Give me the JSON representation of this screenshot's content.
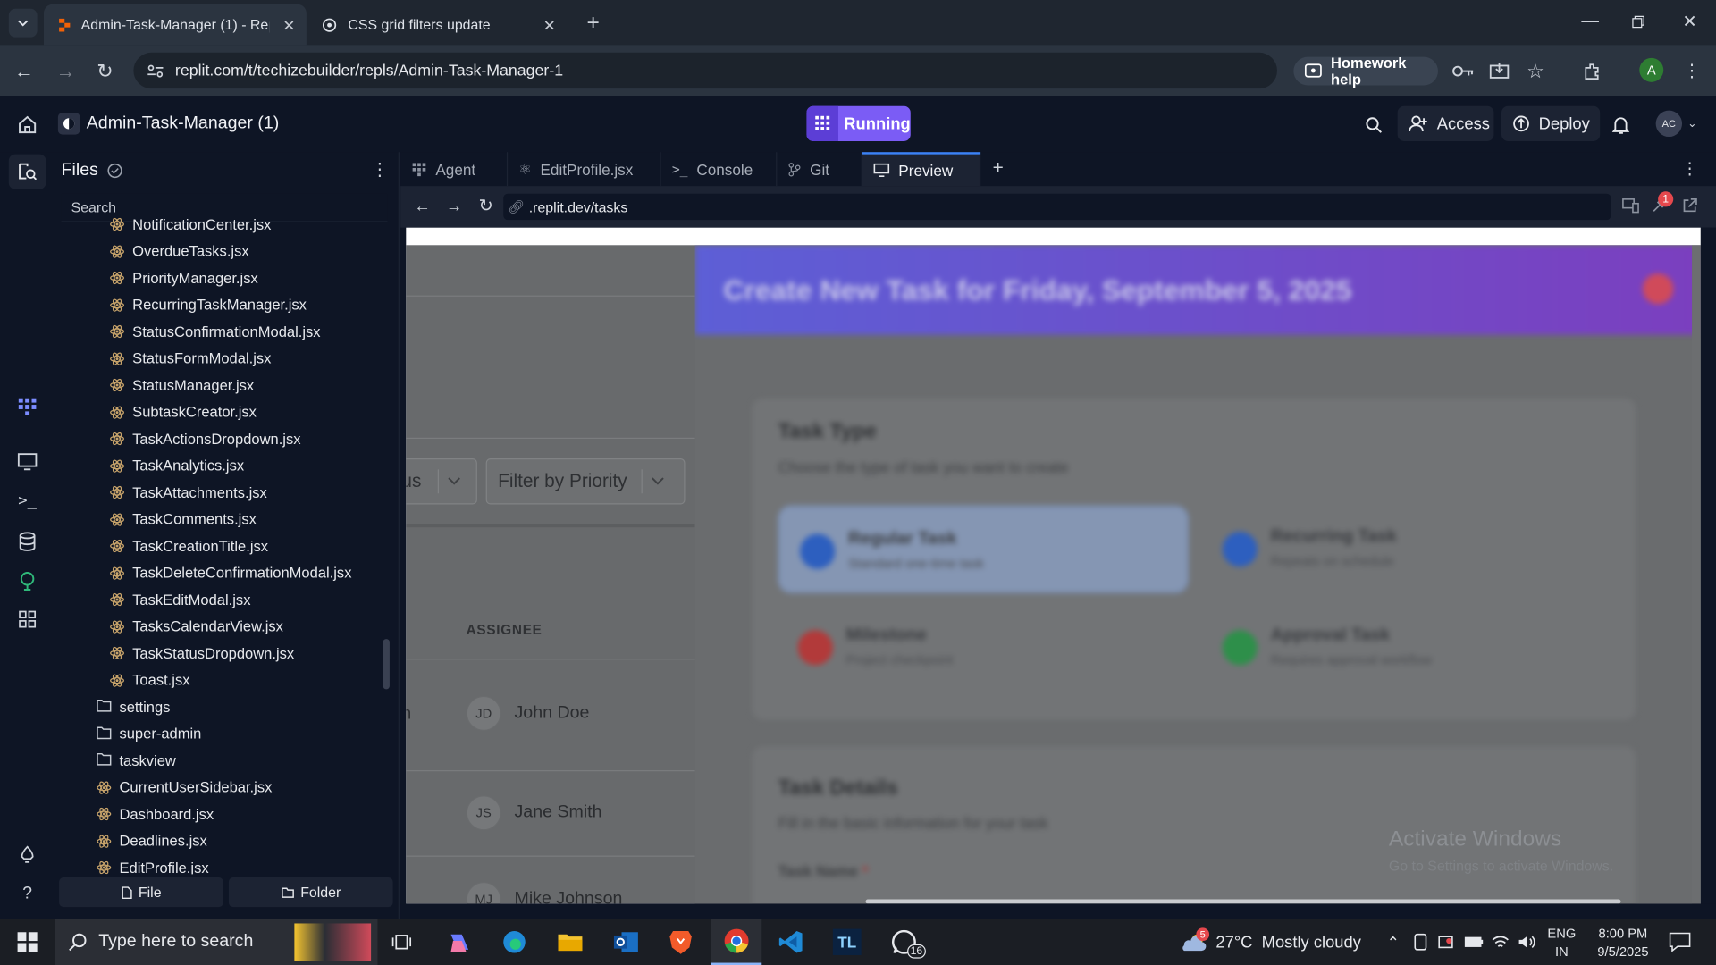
{
  "browser": {
    "tabs": [
      {
        "title": "Admin-Task-Manager (1) - Repl",
        "active": true
      },
      {
        "title": "CSS grid filters update",
        "active": false
      }
    ],
    "url": "replit.com/t/techizebuilder/repls/Admin-Task-Manager-1",
    "homework_help": "Homework help",
    "profile_initial": "A"
  },
  "replit": {
    "project_name": "Admin-Task-Manager (1)",
    "status": "Running",
    "access_label": "Access",
    "deploy_label": "Deploy",
    "avatar_initials": "AC"
  },
  "files": {
    "title": "Files",
    "search_placeholder": "Search",
    "items": [
      {
        "name": "NotificationCenter.jsx",
        "type": "jsx",
        "indent": 2
      },
      {
        "name": "OverdueTasks.jsx",
        "type": "jsx",
        "indent": 2
      },
      {
        "name": "PriorityManager.jsx",
        "type": "jsx",
        "indent": 2
      },
      {
        "name": "RecurringTaskManager.jsx",
        "type": "jsx",
        "indent": 2
      },
      {
        "name": "StatusConfirmationModal.jsx",
        "type": "jsx",
        "indent": 2
      },
      {
        "name": "StatusFormModal.jsx",
        "type": "jsx",
        "indent": 2
      },
      {
        "name": "StatusManager.jsx",
        "type": "jsx",
        "indent": 2
      },
      {
        "name": "SubtaskCreator.jsx",
        "type": "jsx",
        "indent": 2
      },
      {
        "name": "TaskActionsDropdown.jsx",
        "type": "jsx",
        "indent": 2
      },
      {
        "name": "TaskAnalytics.jsx",
        "type": "jsx",
        "indent": 2
      },
      {
        "name": "TaskAttachments.jsx",
        "type": "jsx",
        "indent": 2
      },
      {
        "name": "TaskComments.jsx",
        "type": "jsx",
        "indent": 2
      },
      {
        "name": "TaskCreationTitle.jsx",
        "type": "jsx",
        "indent": 2
      },
      {
        "name": "TaskDeleteConfirmationModal.jsx",
        "type": "jsx",
        "indent": 2
      },
      {
        "name": "TaskEditModal.jsx",
        "type": "jsx",
        "indent": 2
      },
      {
        "name": "TasksCalendarView.jsx",
        "type": "jsx",
        "indent": 2
      },
      {
        "name": "TaskStatusDropdown.jsx",
        "type": "jsx",
        "indent": 2
      },
      {
        "name": "Toast.jsx",
        "type": "jsx",
        "indent": 2
      },
      {
        "name": "settings",
        "type": "folder",
        "indent": 1
      },
      {
        "name": "super-admin",
        "type": "folder",
        "indent": 1
      },
      {
        "name": "taskview",
        "type": "folder",
        "indent": 1
      },
      {
        "name": "CurrentUserSidebar.jsx",
        "type": "jsx",
        "indent": 1
      },
      {
        "name": "Dashboard.jsx",
        "type": "jsx",
        "indent": 1
      },
      {
        "name": "Deadlines.jsx",
        "type": "jsx",
        "indent": 1
      },
      {
        "name": "EditProfile.jsx",
        "type": "jsx",
        "indent": 1
      }
    ],
    "new_file_label": "File",
    "new_folder_label": "Folder"
  },
  "editor_tabs": [
    {
      "label": "Agent",
      "icon": "agent-icon",
      "active": false
    },
    {
      "label": "EditProfile.jsx",
      "icon": "react-icon",
      "active": false
    },
    {
      "label": "Console",
      "icon": "console-icon",
      "active": false
    },
    {
      "label": "Git",
      "icon": "git-icon",
      "active": false
    },
    {
      "label": "Preview",
      "icon": "monitor-icon",
      "active": true
    }
  ],
  "preview": {
    "url": ".replit.dev/tasks",
    "notification_count": "1",
    "app": {
      "filter_status_partial": "us",
      "filter_priority": "Filter by Priority",
      "assignee_header": "ASSIGNEE",
      "rows": [
        {
          "initials": "JD",
          "name": "John Doe",
          "left_char": "n"
        },
        {
          "initials": "JS",
          "name": "Jane Smith",
          "left_char": ""
        },
        {
          "initials": "MJ",
          "name": "Mike Johnson",
          "left_char": ""
        }
      ]
    },
    "modal": {
      "title": "Create New Task for Friday, September 5, 2025",
      "task_type_heading": "Task Type",
      "task_type_sub": "Choose the type of task you want to create",
      "options": [
        {
          "title": "Regular Task",
          "sub": "Standard one-time task",
          "color": "#3b82f6"
        },
        {
          "title": "Recurring Task",
          "sub": "Repeats on schedule",
          "color": "#3b82f6"
        },
        {
          "title": "Milestone",
          "sub": "Project checkpoint",
          "color": "#ef4444"
        },
        {
          "title": "Approval Task",
          "sub": "Requires approval workflow",
          "color": "#22c55e"
        }
      ],
      "details_heading": "Task Details",
      "details_sub": "Fill in the basic information for your task",
      "task_name_label": "Task Name",
      "required_mark": "*"
    },
    "watermark_title": "Activate Windows",
    "watermark_sub": "Go to Settings to activate Windows."
  },
  "taskbar": {
    "search_placeholder": "Type here to search",
    "whatsapp_badge": "16",
    "weather_badge": "5",
    "weather": "27°C  Mostly cloudy",
    "lang_top": "ENG",
    "lang_bottom": "IN",
    "time": "8:00 PM",
    "date": "9/5/2025"
  },
  "colors": {
    "replit_bg": "#0e1525",
    "running": "#7b5cf5",
    "modal_header_start": "#5d5fd6",
    "modal_header_end": "#7b3fbf",
    "jsx_icon": "#c8a46b"
  }
}
